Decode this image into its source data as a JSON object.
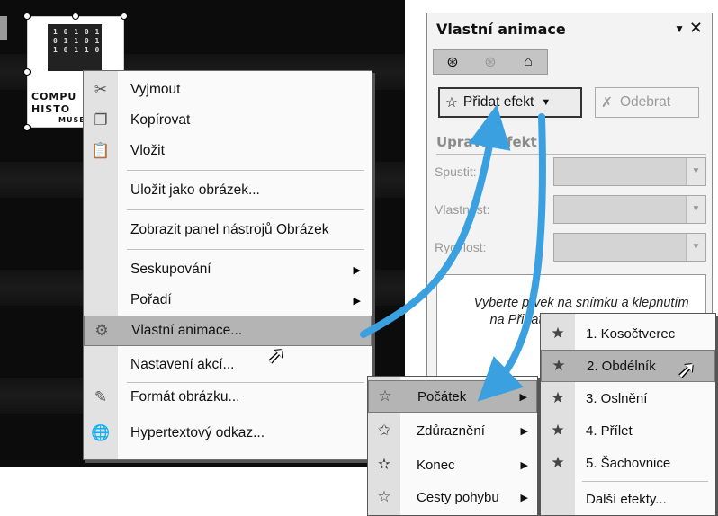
{
  "logo": {
    "line1": "COMPU",
    "line2": "HISTO",
    "line3": "MUSE",
    "chip": "1 0 1 0 1\n0 1 1 0 1\n1 0 1 1 0"
  },
  "context_menu": {
    "items": [
      {
        "label": "Vyjmout",
        "icon": "scissors-icon"
      },
      {
        "label": "Kopírovat",
        "icon": "copy-icon"
      },
      {
        "label": "Vložit",
        "icon": "paste-icon"
      },
      {
        "label": "Uložit jako obrázek..."
      },
      {
        "label": "Zobrazit panel nástrojů Obrázek"
      },
      {
        "label": "Seskupování"
      },
      {
        "label": "Pořadí"
      },
      {
        "label": "Vlastní animace..."
      },
      {
        "label": "Nastavení akcí..."
      },
      {
        "label": "Formát obrázku..."
      },
      {
        "label": "Hypertextový odkaz..."
      }
    ]
  },
  "task_pane": {
    "title": "Vlastní animace",
    "add_effect": "Přidat efekt",
    "remove": "Odebrat",
    "section_title": "Upravit efekt",
    "fields": [
      "Spustit:",
      "Vlastnost:",
      "Rychlost:"
    ],
    "hint": "Vyberte prvek na snímku a klepnutím na Přidat efekt přidejte animaci."
  },
  "effect_types": [
    {
      "label": "Počátek"
    },
    {
      "label": "Zdůraznění"
    },
    {
      "label": "Konec"
    },
    {
      "label": "Cesty pohybu"
    }
  ],
  "effects": [
    {
      "label": "1. Kosočtverec"
    },
    {
      "label": "2. Obdélník"
    },
    {
      "label": "3. Oslnění"
    },
    {
      "label": "4. Přílet"
    },
    {
      "label": "5. Šachovnice"
    },
    {
      "label": "Další efekty..."
    }
  ],
  "colors": {
    "arrow": "#3aa0e0",
    "highlight": "#b4b4b4"
  }
}
